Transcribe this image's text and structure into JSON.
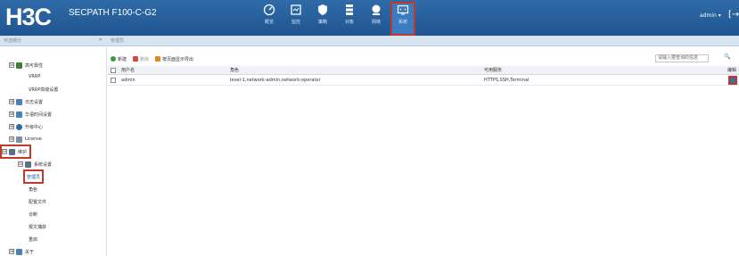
{
  "header": {
    "logo": "H3C",
    "product": "SECPATH F100-C-G2",
    "nav": [
      {
        "label": "概览",
        "icon": "dashboard-icon"
      },
      {
        "label": "监控",
        "icon": "monitor-icon"
      },
      {
        "label": "策略",
        "icon": "shield-icon"
      },
      {
        "label": "对象",
        "icon": "stack-icon"
      },
      {
        "label": "网络",
        "icon": "globe-icon"
      },
      {
        "label": "系统",
        "icon": "system-icon"
      }
    ],
    "user": "admin ▾",
    "logout_glyph": "[→"
  },
  "subbar": {
    "left": "可选细分",
    "collapse": "«",
    "breadcrumb": "管理员"
  },
  "sidebar": {
    "items": [
      {
        "label": "高可靠性",
        "toggle": "⊟",
        "level": 0
      },
      {
        "label": "VRRP",
        "level": 1
      },
      {
        "label": "VRRP高级设置",
        "level": 1
      },
      {
        "label": "日志设置",
        "toggle": "⊞",
        "level": 0
      },
      {
        "label": "华语时间设置",
        "toggle": "⊞",
        "level": 0
      },
      {
        "label": "升级中心",
        "toggle": "⊞",
        "level": 0
      },
      {
        "label": "License",
        "toggle": "⊞",
        "level": 0
      },
      {
        "label": "维护",
        "toggle": "⊟",
        "level": 0
      },
      {
        "label": "系统设置",
        "toggle": "⊟",
        "level": 1
      },
      {
        "label": "管理员",
        "level": 2
      },
      {
        "label": "角色",
        "level": 2
      },
      {
        "label": "配置文件",
        "level": 2
      },
      {
        "label": "诊断",
        "level": 2
      },
      {
        "label": "报文捕获",
        "level": 2
      },
      {
        "label": "重启",
        "level": 2
      },
      {
        "label": "关于",
        "toggle": "⊞",
        "level": 0
      }
    ]
  },
  "toolbar": {
    "new": "新建",
    "delete": "删除",
    "export": "按页面显示导出",
    "search_placeholder": "请输入要查询的信息",
    "search_icon": "🔍"
  },
  "table": {
    "headers": [
      "用户名",
      "角色",
      "可用服务",
      "编辑"
    ],
    "rows": [
      {
        "username": "admin",
        "role": "level-1,network-admin,network-operator",
        "services": "HTTPS,SSH,Terminal"
      }
    ]
  }
}
